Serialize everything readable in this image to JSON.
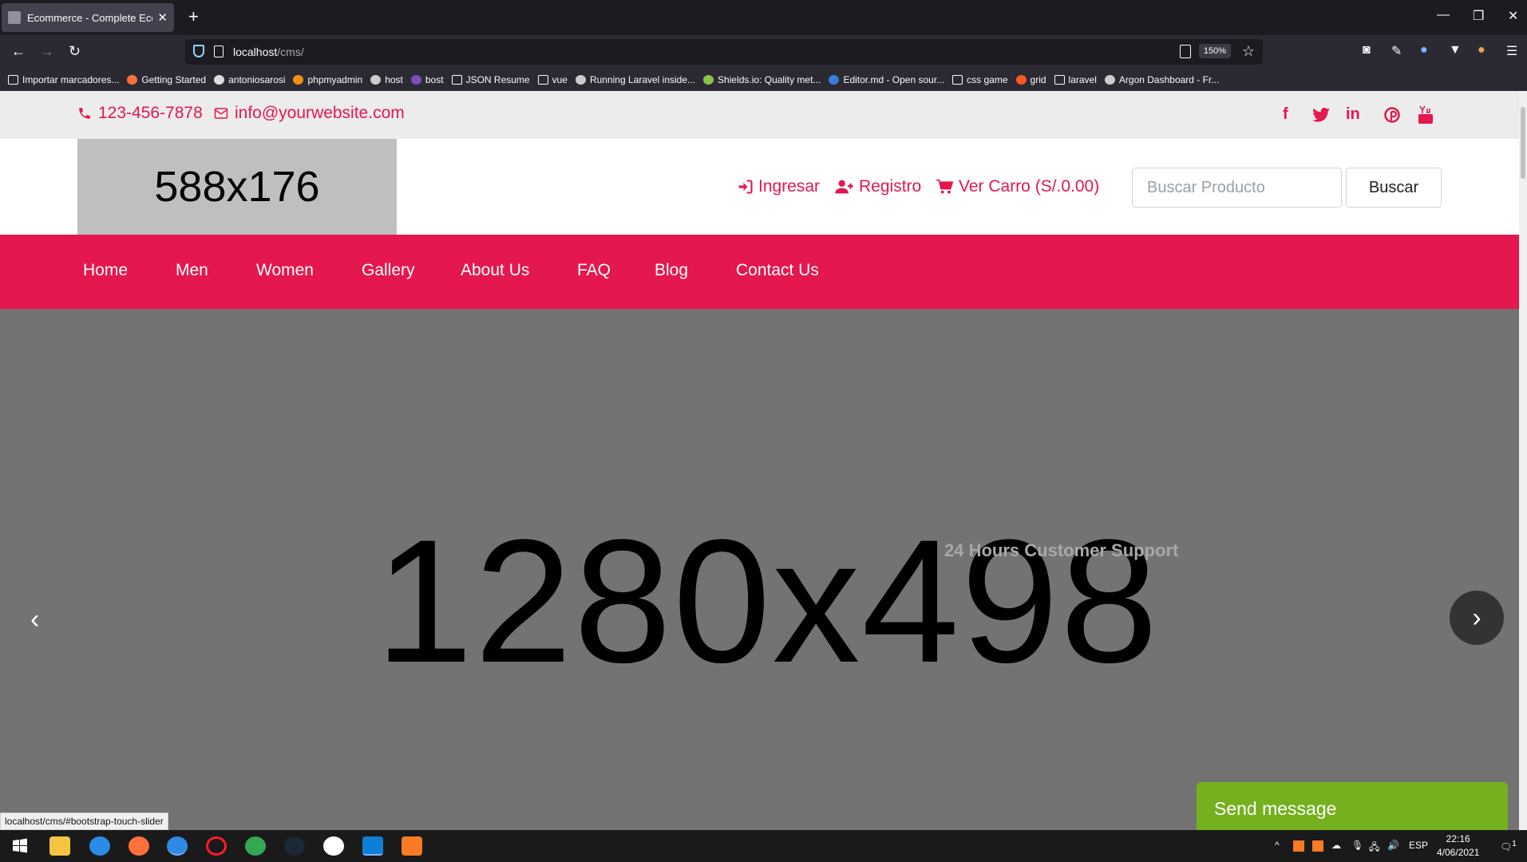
{
  "browser": {
    "tab_title": "Ecommerce - Complete Ecomm",
    "tab_close": "✕",
    "new_tab": "+",
    "url_host": "localhost",
    "url_path": "/cms/",
    "zoom": "150%",
    "bookmarks": [
      "Importar marcadores...",
      "Getting Started",
      "antoniosarosi",
      "phpmyadmin",
      "host",
      "bost",
      "JSON Resume",
      "vue",
      "Running Laravel inside...",
      "Shields.io: Quality met...",
      "Editor.md - Open sour...",
      "css game",
      "grid",
      "laravel",
      "Argon Dashboard - Fr..."
    ]
  },
  "topbar": {
    "phone": "123-456-7878",
    "email": "info@yourwebsite.com"
  },
  "header": {
    "logo_text": "588x176",
    "login": "Ingresar",
    "register": "Registro",
    "cart": "Ver Carro (S/.0.00)",
    "search_placeholder": "Buscar Producto",
    "search_button": "Buscar"
  },
  "nav": {
    "items": [
      "Home",
      "Men",
      "Women",
      "Gallery",
      "About Us",
      "FAQ",
      "Blog",
      "Contact Us"
    ]
  },
  "slider": {
    "placeholder_text": "1280x498",
    "caption": "24 Hours Customer Support"
  },
  "status_url": "localhost/cms/#bootstrap-touch-slider",
  "chat": {
    "label": "Send message"
  },
  "taskbar": {
    "lang": "ESP",
    "time": "22:16",
    "date": "4/06/2021",
    "notification_count": "1"
  },
  "colors": {
    "brand": "#e4174f",
    "chat": "#75b11f",
    "slider_bg": "#737373"
  }
}
